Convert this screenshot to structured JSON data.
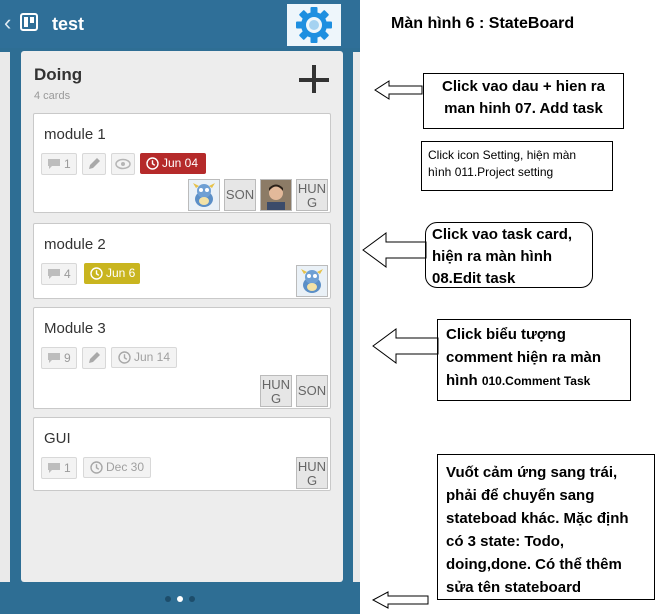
{
  "app": {
    "back_icon": "back-arrow-icon",
    "board_icon": "board-icon",
    "title": "test",
    "settings_icon": "gear-icon"
  },
  "column": {
    "title": "Doing",
    "subtitle": "4 cards",
    "add_icon": "plus-icon"
  },
  "cards": [
    {
      "title": "module 1",
      "comments": "1",
      "has_edit": true,
      "has_watch": true,
      "due": "Jun 04",
      "due_status": "overdue",
      "members": [
        "avatar-dragon",
        "SON",
        "avatar-photo",
        "HUNG"
      ]
    },
    {
      "title": "module 2",
      "comments": "4",
      "due": "Jun 6",
      "due_status": "soon",
      "members": [
        "avatar-dragon"
      ]
    },
    {
      "title": "Module 3",
      "comments": "9",
      "has_edit": true,
      "due": "Jun 14",
      "due_status": "normal",
      "members": [
        "HUNG",
        "SON"
      ]
    },
    {
      "title": "GUI",
      "comments": "1",
      "due": "Dec 30",
      "due_status": "normal",
      "members": [
        "HUNG"
      ]
    }
  ],
  "member_labels": {
    "hung_l1": "HUN",
    "hung_l2": "G",
    "son": "SON"
  },
  "pager": {
    "pages": 3,
    "active": 2
  },
  "colors": {
    "header": "#2f6f98",
    "overdue": "#b52a2a",
    "soon": "#c9b51f"
  },
  "annotations": {
    "heading": "Màn hình 6 : StateBoard",
    "add_task": "Click vao dau + hien ra\nman hinh 07. Add task",
    "project_setting": "Click icon Setting, hiện màn\nhình 011.Project setting",
    "edit_task": "Click vao task card,\nhiện ra màn hình\n08.Edit task",
    "comment_main": "Click biểu tượng\ncomment hiện ra màn\nhình ",
    "comment_small": "010.Comment Task",
    "swipe": "Vuốt cảm ứng sang trái,\nphải để chuyển sang\nstateboad khác. Mặc định\ncó 3 state: Todo,\ndoing,done. Có thể thêm\nsửa tên stateboard"
  }
}
